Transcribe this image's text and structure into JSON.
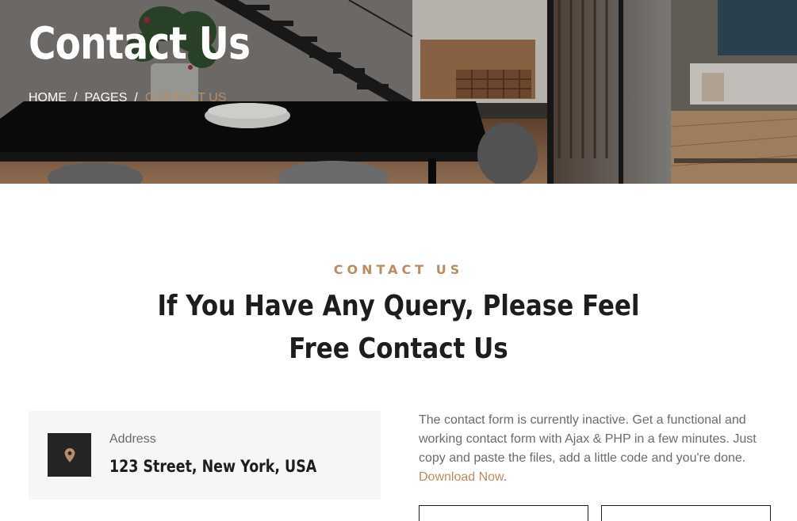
{
  "hero": {
    "title": "Contact Us",
    "breadcrumb": {
      "home": "HOME",
      "pages": "PAGES",
      "current": "CONTACT US",
      "separator": "/"
    }
  },
  "section": {
    "subtitle": "CONTACT US",
    "title_line1": "If You Have Any Query, Please Feel",
    "title_line2": "Free Contact Us"
  },
  "info": {
    "label": "Address",
    "value": "123 Street, New York, USA",
    "icon": "map-marker-icon"
  },
  "form_note": {
    "text": "The contact form is currently inactive. Get a functional and working contact form with Ajax & PHP in a few minutes. Just copy and paste the files, add a little code and you're done. ",
    "link": "Download Now",
    "end": "."
  },
  "colors": {
    "accent": "#b78d65",
    "dark": "#1d1d1d",
    "muted": "#6b6b6b",
    "card_bg": "#f6f6f6",
    "icon_box": "#242424"
  }
}
